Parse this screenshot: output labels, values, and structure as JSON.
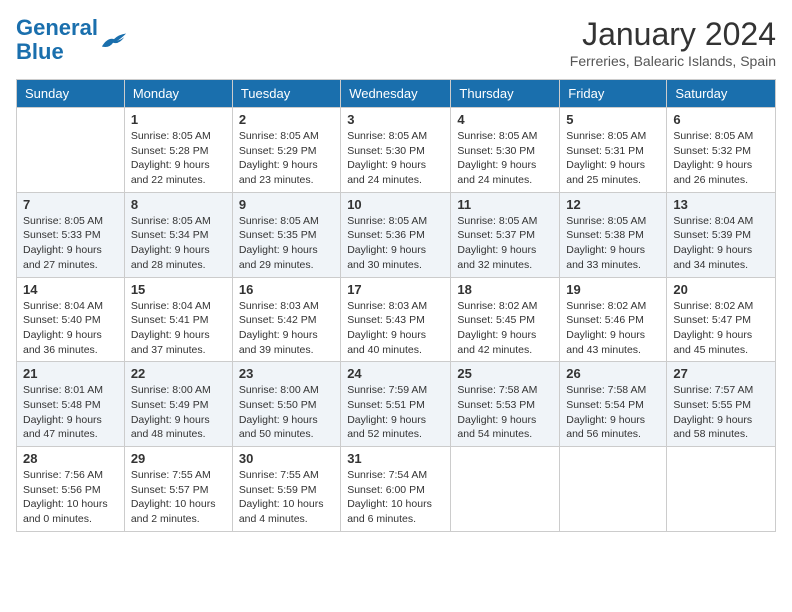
{
  "logo": {
    "text_general": "General",
    "text_blue": "Blue"
  },
  "title": "January 2024",
  "location": "Ferreries, Balearic Islands, Spain",
  "days_of_week": [
    "Sunday",
    "Monday",
    "Tuesday",
    "Wednesday",
    "Thursday",
    "Friday",
    "Saturday"
  ],
  "weeks": [
    [
      {
        "day": "",
        "sunrise": "",
        "sunset": "",
        "daylight": ""
      },
      {
        "day": "1",
        "sunrise": "Sunrise: 8:05 AM",
        "sunset": "Sunset: 5:28 PM",
        "daylight": "Daylight: 9 hours and 22 minutes."
      },
      {
        "day": "2",
        "sunrise": "Sunrise: 8:05 AM",
        "sunset": "Sunset: 5:29 PM",
        "daylight": "Daylight: 9 hours and 23 minutes."
      },
      {
        "day": "3",
        "sunrise": "Sunrise: 8:05 AM",
        "sunset": "Sunset: 5:30 PM",
        "daylight": "Daylight: 9 hours and 24 minutes."
      },
      {
        "day": "4",
        "sunrise": "Sunrise: 8:05 AM",
        "sunset": "Sunset: 5:30 PM",
        "daylight": "Daylight: 9 hours and 24 minutes."
      },
      {
        "day": "5",
        "sunrise": "Sunrise: 8:05 AM",
        "sunset": "Sunset: 5:31 PM",
        "daylight": "Daylight: 9 hours and 25 minutes."
      },
      {
        "day": "6",
        "sunrise": "Sunrise: 8:05 AM",
        "sunset": "Sunset: 5:32 PM",
        "daylight": "Daylight: 9 hours and 26 minutes."
      }
    ],
    [
      {
        "day": "7",
        "sunrise": "Sunrise: 8:05 AM",
        "sunset": "Sunset: 5:33 PM",
        "daylight": "Daylight: 9 hours and 27 minutes."
      },
      {
        "day": "8",
        "sunrise": "Sunrise: 8:05 AM",
        "sunset": "Sunset: 5:34 PM",
        "daylight": "Daylight: 9 hours and 28 minutes."
      },
      {
        "day": "9",
        "sunrise": "Sunrise: 8:05 AM",
        "sunset": "Sunset: 5:35 PM",
        "daylight": "Daylight: 9 hours and 29 minutes."
      },
      {
        "day": "10",
        "sunrise": "Sunrise: 8:05 AM",
        "sunset": "Sunset: 5:36 PM",
        "daylight": "Daylight: 9 hours and 30 minutes."
      },
      {
        "day": "11",
        "sunrise": "Sunrise: 8:05 AM",
        "sunset": "Sunset: 5:37 PM",
        "daylight": "Daylight: 9 hours and 32 minutes."
      },
      {
        "day": "12",
        "sunrise": "Sunrise: 8:05 AM",
        "sunset": "Sunset: 5:38 PM",
        "daylight": "Daylight: 9 hours and 33 minutes."
      },
      {
        "day": "13",
        "sunrise": "Sunrise: 8:04 AM",
        "sunset": "Sunset: 5:39 PM",
        "daylight": "Daylight: 9 hours and 34 minutes."
      }
    ],
    [
      {
        "day": "14",
        "sunrise": "Sunrise: 8:04 AM",
        "sunset": "Sunset: 5:40 PM",
        "daylight": "Daylight: 9 hours and 36 minutes."
      },
      {
        "day": "15",
        "sunrise": "Sunrise: 8:04 AM",
        "sunset": "Sunset: 5:41 PM",
        "daylight": "Daylight: 9 hours and 37 minutes."
      },
      {
        "day": "16",
        "sunrise": "Sunrise: 8:03 AM",
        "sunset": "Sunset: 5:42 PM",
        "daylight": "Daylight: 9 hours and 39 minutes."
      },
      {
        "day": "17",
        "sunrise": "Sunrise: 8:03 AM",
        "sunset": "Sunset: 5:43 PM",
        "daylight": "Daylight: 9 hours and 40 minutes."
      },
      {
        "day": "18",
        "sunrise": "Sunrise: 8:02 AM",
        "sunset": "Sunset: 5:45 PM",
        "daylight": "Daylight: 9 hours and 42 minutes."
      },
      {
        "day": "19",
        "sunrise": "Sunrise: 8:02 AM",
        "sunset": "Sunset: 5:46 PM",
        "daylight": "Daylight: 9 hours and 43 minutes."
      },
      {
        "day": "20",
        "sunrise": "Sunrise: 8:02 AM",
        "sunset": "Sunset: 5:47 PM",
        "daylight": "Daylight: 9 hours and 45 minutes."
      }
    ],
    [
      {
        "day": "21",
        "sunrise": "Sunrise: 8:01 AM",
        "sunset": "Sunset: 5:48 PM",
        "daylight": "Daylight: 9 hours and 47 minutes."
      },
      {
        "day": "22",
        "sunrise": "Sunrise: 8:00 AM",
        "sunset": "Sunset: 5:49 PM",
        "daylight": "Daylight: 9 hours and 48 minutes."
      },
      {
        "day": "23",
        "sunrise": "Sunrise: 8:00 AM",
        "sunset": "Sunset: 5:50 PM",
        "daylight": "Daylight: 9 hours and 50 minutes."
      },
      {
        "day": "24",
        "sunrise": "Sunrise: 7:59 AM",
        "sunset": "Sunset: 5:51 PM",
        "daylight": "Daylight: 9 hours and 52 minutes."
      },
      {
        "day": "25",
        "sunrise": "Sunrise: 7:58 AM",
        "sunset": "Sunset: 5:53 PM",
        "daylight": "Daylight: 9 hours and 54 minutes."
      },
      {
        "day": "26",
        "sunrise": "Sunrise: 7:58 AM",
        "sunset": "Sunset: 5:54 PM",
        "daylight": "Daylight: 9 hours and 56 minutes."
      },
      {
        "day": "27",
        "sunrise": "Sunrise: 7:57 AM",
        "sunset": "Sunset: 5:55 PM",
        "daylight": "Daylight: 9 hours and 58 minutes."
      }
    ],
    [
      {
        "day": "28",
        "sunrise": "Sunrise: 7:56 AM",
        "sunset": "Sunset: 5:56 PM",
        "daylight": "Daylight: 10 hours and 0 minutes."
      },
      {
        "day": "29",
        "sunrise": "Sunrise: 7:55 AM",
        "sunset": "Sunset: 5:57 PM",
        "daylight": "Daylight: 10 hours and 2 minutes."
      },
      {
        "day": "30",
        "sunrise": "Sunrise: 7:55 AM",
        "sunset": "Sunset: 5:59 PM",
        "daylight": "Daylight: 10 hours and 4 minutes."
      },
      {
        "day": "31",
        "sunrise": "Sunrise: 7:54 AM",
        "sunset": "Sunset: 6:00 PM",
        "daylight": "Daylight: 10 hours and 6 minutes."
      },
      {
        "day": "",
        "sunrise": "",
        "sunset": "",
        "daylight": ""
      },
      {
        "day": "",
        "sunrise": "",
        "sunset": "",
        "daylight": ""
      },
      {
        "day": "",
        "sunrise": "",
        "sunset": "",
        "daylight": ""
      }
    ]
  ]
}
